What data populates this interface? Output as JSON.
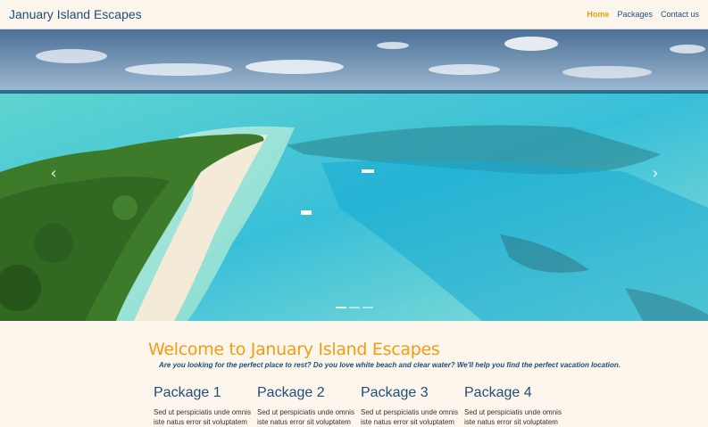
{
  "brand": "January Island Escapes",
  "nav": {
    "items": [
      {
        "label": "Home",
        "active": true
      },
      {
        "label": "Packages",
        "active": false
      },
      {
        "label": "Contact us",
        "active": false
      }
    ]
  },
  "carousel": {
    "prev_icon": "chevron-left",
    "next_icon": "chevron-right",
    "indicator_count": 3,
    "active_index": 0
  },
  "welcome": {
    "title": "Welcome to January Island Escapes",
    "tagline": "Are you looking for the perfect place to rest? Do you love white beach and clear water? We'll help you find the perfect vacation location."
  },
  "packages": [
    {
      "title": "Package 1",
      "text": "Sed ut perspiciatis unde omnis iste natus error sit voluptatem"
    },
    {
      "title": "Package 2",
      "text": "Sed ut perspiciatis unde omnis iste natus error sit voluptatem"
    },
    {
      "title": "Package 3",
      "text": "Sed ut perspiciatis unde omnis iste natus error sit voluptatem"
    },
    {
      "title": "Package 4",
      "text": "Sed ut perspiciatis unde omnis iste natus error sit voluptatem"
    }
  ],
  "colors": {
    "page_bg": "#fdf6ec",
    "brand": "#1f4e7a",
    "accent": "#f39c12"
  }
}
